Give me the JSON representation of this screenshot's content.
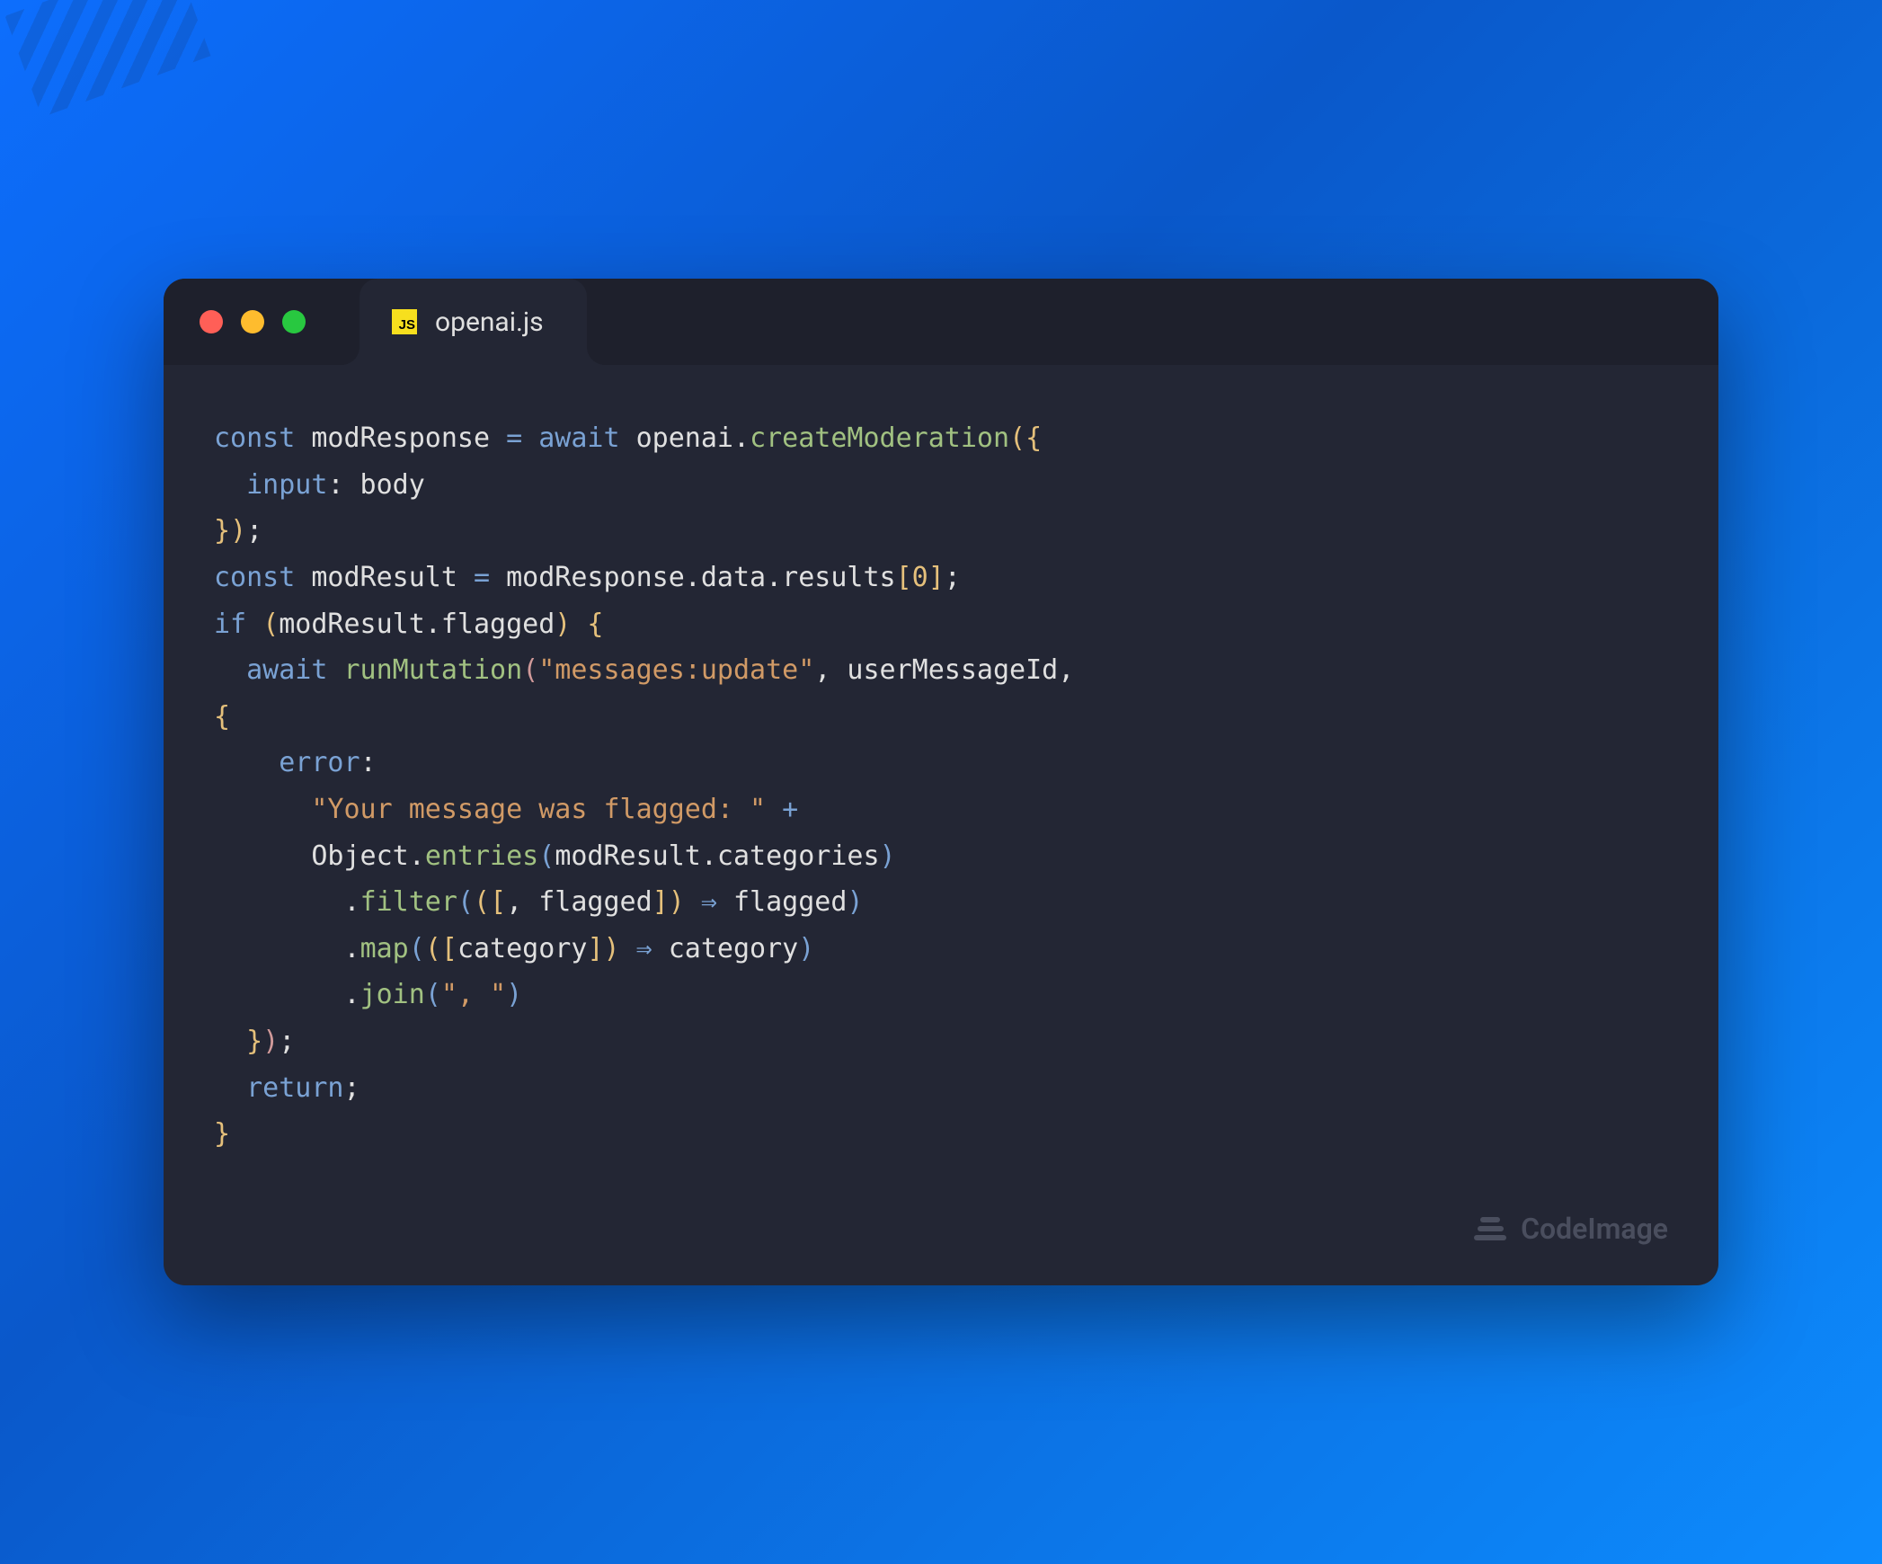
{
  "window": {
    "tab": {
      "filename": "openai.js",
      "icon_label": "JS"
    }
  },
  "code": {
    "lines": [
      {
        "t": [
          {
            "c": "tok-keyword",
            "v": "const"
          },
          {
            "c": "",
            "v": " modResponse "
          },
          {
            "c": "tok-operator",
            "v": "="
          },
          {
            "c": "",
            "v": " "
          },
          {
            "c": "tok-await",
            "v": "await"
          },
          {
            "c": "",
            "v": " openai."
          },
          {
            "c": "tok-method",
            "v": "createModeration"
          },
          {
            "c": "tok-paren",
            "v": "("
          },
          {
            "c": "tok-brace",
            "v": "{"
          }
        ]
      },
      {
        "t": [
          {
            "c": "",
            "v": "  "
          },
          {
            "c": "tok-property",
            "v": "input"
          },
          {
            "c": "",
            "v": ": body"
          }
        ]
      },
      {
        "t": [
          {
            "c": "tok-brace",
            "v": "}"
          },
          {
            "c": "tok-paren",
            "v": ")"
          },
          {
            "c": "",
            "v": ";"
          }
        ]
      },
      {
        "t": [
          {
            "c": "tok-keyword",
            "v": "const"
          },
          {
            "c": "",
            "v": " modResult "
          },
          {
            "c": "tok-operator",
            "v": "="
          },
          {
            "c": "",
            "v": " modResponse.data.results"
          },
          {
            "c": "tok-bracket",
            "v": "["
          },
          {
            "c": "tok-number",
            "v": "0"
          },
          {
            "c": "tok-bracket",
            "v": "]"
          },
          {
            "c": "",
            "v": ";"
          }
        ]
      },
      {
        "t": [
          {
            "c": "tok-keyword",
            "v": "if"
          },
          {
            "c": "",
            "v": " "
          },
          {
            "c": "tok-paren",
            "v": "("
          },
          {
            "c": "",
            "v": "modResult.flagged"
          },
          {
            "c": "tok-paren",
            "v": ")"
          },
          {
            "c": "",
            "v": " "
          },
          {
            "c": "tok-brace",
            "v": "{"
          }
        ]
      },
      {
        "t": [
          {
            "c": "",
            "v": "  "
          },
          {
            "c": "tok-await",
            "v": "await"
          },
          {
            "c": "",
            "v": " "
          },
          {
            "c": "tok-method",
            "v": "runMutation"
          },
          {
            "c": "tok-paren-pink",
            "v": "("
          },
          {
            "c": "tok-string",
            "v": "\"messages:update\""
          },
          {
            "c": "",
            "v": ", userMessageId, "
          }
        ]
      },
      {
        "t": [
          {
            "c": "tok-brace",
            "v": "{"
          }
        ]
      },
      {
        "t": [
          {
            "c": "",
            "v": "    "
          },
          {
            "c": "tok-property",
            "v": "error"
          },
          {
            "c": "",
            "v": ":"
          }
        ]
      },
      {
        "t": [
          {
            "c": "",
            "v": "      "
          },
          {
            "c": "tok-string",
            "v": "\"Your message was flagged: \""
          },
          {
            "c": "",
            "v": " "
          },
          {
            "c": "tok-plus",
            "v": "+"
          }
        ]
      },
      {
        "t": [
          {
            "c": "",
            "v": "      Object."
          },
          {
            "c": "tok-method",
            "v": "entries"
          },
          {
            "c": "tok-paren-blue",
            "v": "("
          },
          {
            "c": "",
            "v": "modResult.categories"
          },
          {
            "c": "tok-paren-blue",
            "v": ")"
          }
        ]
      },
      {
        "t": [
          {
            "c": "",
            "v": "        ."
          },
          {
            "c": "tok-method",
            "v": "filter"
          },
          {
            "c": "tok-paren-blue",
            "v": "("
          },
          {
            "c": "tok-paren",
            "v": "("
          },
          {
            "c": "tok-bracket",
            "v": "["
          },
          {
            "c": "",
            "v": ", flagged"
          },
          {
            "c": "tok-bracket",
            "v": "]"
          },
          {
            "c": "tok-paren",
            "v": ")"
          },
          {
            "c": "",
            "v": " "
          },
          {
            "c": "tok-arrow",
            "v": "⇒"
          },
          {
            "c": "",
            "v": " flagged"
          },
          {
            "c": "tok-paren-blue",
            "v": ")"
          }
        ]
      },
      {
        "t": [
          {
            "c": "",
            "v": "        ."
          },
          {
            "c": "tok-method",
            "v": "map"
          },
          {
            "c": "tok-paren-blue",
            "v": "("
          },
          {
            "c": "tok-paren",
            "v": "("
          },
          {
            "c": "tok-bracket",
            "v": "["
          },
          {
            "c": "",
            "v": "category"
          },
          {
            "c": "tok-bracket",
            "v": "]"
          },
          {
            "c": "tok-paren",
            "v": ")"
          },
          {
            "c": "",
            "v": " "
          },
          {
            "c": "tok-arrow",
            "v": "⇒"
          },
          {
            "c": "",
            "v": " category"
          },
          {
            "c": "tok-paren-blue",
            "v": ")"
          }
        ]
      },
      {
        "t": [
          {
            "c": "",
            "v": "        ."
          },
          {
            "c": "tok-method",
            "v": "join"
          },
          {
            "c": "tok-paren-blue",
            "v": "("
          },
          {
            "c": "tok-string",
            "v": "\", \""
          },
          {
            "c": "tok-paren-blue",
            "v": ")"
          }
        ]
      },
      {
        "t": [
          {
            "c": "",
            "v": "  "
          },
          {
            "c": "tok-brace",
            "v": "}"
          },
          {
            "c": "tok-paren-pink",
            "v": ")"
          },
          {
            "c": "",
            "v": ";"
          }
        ]
      },
      {
        "t": [
          {
            "c": "",
            "v": "  "
          },
          {
            "c": "tok-keyword",
            "v": "return"
          },
          {
            "c": "",
            "v": ";"
          }
        ]
      },
      {
        "t": [
          {
            "c": "tok-brace",
            "v": "}"
          }
        ]
      }
    ]
  },
  "watermark": {
    "text": "CodeImage"
  }
}
